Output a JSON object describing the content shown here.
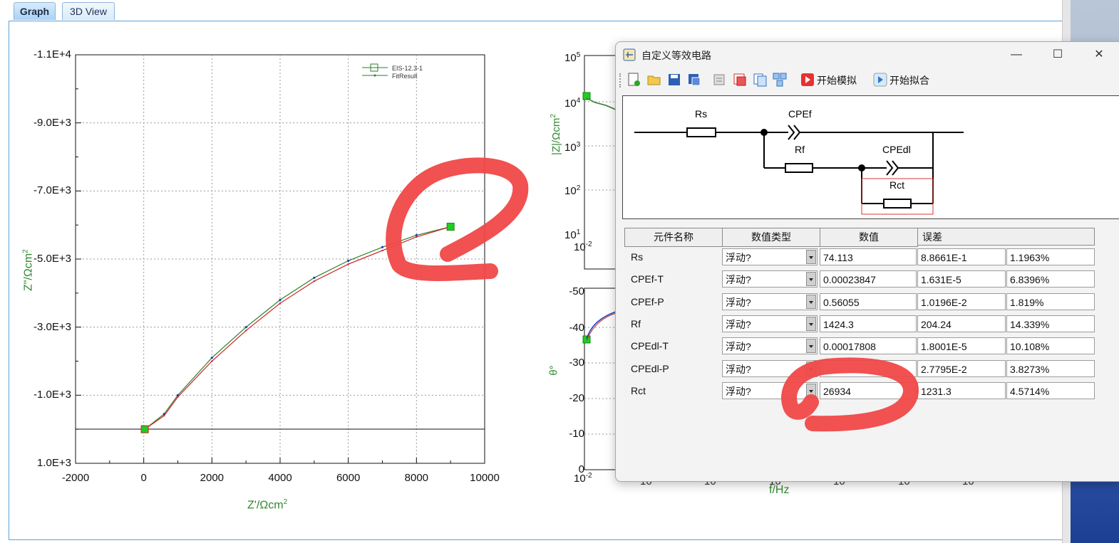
{
  "tabs": [
    {
      "label": "Graph",
      "active": true
    },
    {
      "label": "3D View",
      "active": false
    }
  ],
  "nyquist": {
    "x_label": "Z'/Ωcm",
    "x_label_sup": "2",
    "y_label": "Z\"/Ωcm",
    "y_label_sup": "2",
    "x_ticks": [
      "-2000",
      "0",
      "2000",
      "4000",
      "6000",
      "8000",
      "10000"
    ],
    "y_ticks": [
      "-1.1E+4",
      "-9.0E+3",
      "-7.0E+3",
      "-5.0E+3",
      "-3.0E+3",
      "-1.0E+3",
      "1.0E+3"
    ],
    "legend": [
      "EIS-12.3-1",
      "FitResult"
    ]
  },
  "bode_mag": {
    "y_label": "|Z|/Ωcm",
    "y_label_sup": "2",
    "y_ticks": [
      {
        "base": "10",
        "exp": "5"
      },
      {
        "base": "10",
        "exp": "4"
      },
      {
        "base": "10",
        "exp": "3"
      },
      {
        "base": "10",
        "exp": "2"
      },
      {
        "base": "10",
        "exp": "1"
      }
    ],
    "x_tick_first": {
      "base": "10",
      "exp": "-2"
    }
  },
  "bode_phase": {
    "y_label": "θ°",
    "y_ticks": [
      "-50",
      "-40",
      "-30",
      "-20",
      "-10",
      "0"
    ],
    "x_tick_first": {
      "base": "10",
      "exp": "-2"
    },
    "x_ticks_rest": [
      "10",
      "10",
      "10",
      "10",
      "10"
    ],
    "x_label": "f/Hz"
  },
  "chart_data": [
    {
      "type": "scatter",
      "title": "",
      "xlabel": "Z'/Ωcm2",
      "ylabel": "Z\"/Ωcm2",
      "xlim": [
        -2000,
        10000
      ],
      "ylim": [
        1000,
        -11000
      ],
      "grid": true,
      "legend_position": "top-right",
      "series": [
        {
          "name": "EIS-12.3-1",
          "x": [
            30,
            600,
            1000,
            2000,
            3000,
            4000,
            5000,
            6000,
            7000,
            8000,
            9000
          ],
          "y": [
            0,
            -450,
            -1000,
            -2100,
            -3000,
            -3800,
            -4450,
            -4950,
            -5350,
            -5700,
            -5950
          ]
        },
        {
          "name": "FitResult",
          "x": [
            30,
            600,
            1000,
            2000,
            3000,
            4000,
            5000,
            6000,
            7000,
            8000,
            9000
          ],
          "y": [
            0,
            -400,
            -950,
            -2000,
            -2900,
            -3700,
            -4350,
            -4850,
            -5250,
            -5650,
            -5950
          ]
        }
      ]
    }
  ],
  "dialog": {
    "title": "自定义等效电路",
    "toolbar": {
      "simulate": "开始模拟",
      "fit": "开始拟合"
    },
    "window_controls": {
      "minimize": "—",
      "maximize": "☐",
      "close": "✕"
    },
    "circuit_labels": {
      "rs": "Rs",
      "cpef": "CPEf",
      "rf": "Rf",
      "cpedl": "CPEdl",
      "rct": "Rct"
    },
    "table": {
      "headers": [
        "元件名称",
        "数值类型",
        "数值",
        "误差"
      ],
      "rows": [
        {
          "name": "Rs",
          "type": "浮动?",
          "value": "74.113",
          "error": "8.8661E-1",
          "percent": "1.1963%"
        },
        {
          "name": "CPEf-T",
          "type": "浮动?",
          "value": "0.00023847",
          "error": "1.631E-5",
          "percent": "6.8396%"
        },
        {
          "name": "CPEf-P",
          "type": "浮动?",
          "value": "0.56055",
          "error": "1.0196E-2",
          "percent": "1.819%"
        },
        {
          "name": "Rf",
          "type": "浮动?",
          "value": "1424.3",
          "error": "204.24",
          "percent": "14.339%"
        },
        {
          "name": "CPEdl-T",
          "type": "浮动?",
          "value": "0.00017808",
          "error": "1.8001E-5",
          "percent": "10.108%"
        },
        {
          "name": "CPEdl-P",
          "type": "浮动?",
          "value": "",
          "error": "2.7795E-2",
          "percent": "3.8273%"
        },
        {
          "name": "Rct",
          "type": "浮动?",
          "value": "26934",
          "error": "1231.3",
          "percent": "4.5714%"
        }
      ]
    }
  },
  "colors": {
    "annotation": "#f04848",
    "data_series": "#2e7d2e",
    "fit_series": "#cc2222",
    "accent_blue": "#1a6fc9"
  }
}
